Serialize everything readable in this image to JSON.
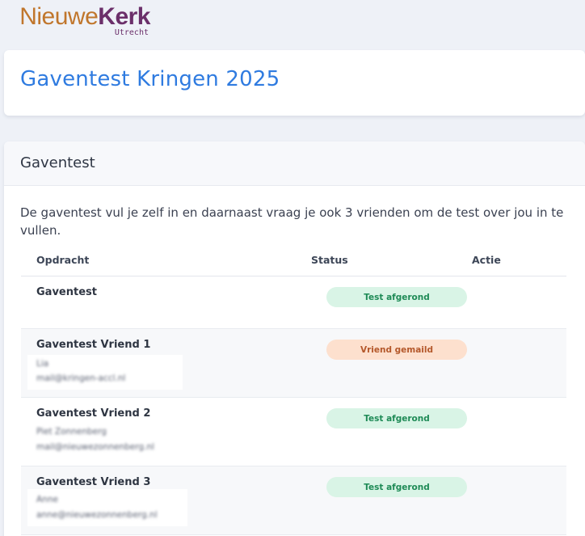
{
  "logo": {
    "part1": "Nieuwe",
    "part2": "Kerk",
    "sub": "Utrecht",
    "color_part1": "#c0762c",
    "color_part2": "#6b2f6a"
  },
  "page": {
    "title": "Gaventest Kringen 2025"
  },
  "card": {
    "title": "Gaventest",
    "intro": "De gaventest vul je zelf in en daarnaast vraag je ook 3 vrienden om de test over jou in te vullen."
  },
  "table": {
    "headers": [
      "Opdracht",
      "Status",
      "Actie"
    ],
    "rows": [
      {
        "title": "Gaventest",
        "status": "Test afgerond",
        "status_color": "green",
        "line1": "",
        "line2": ""
      },
      {
        "title": "Gaventest Vriend 1",
        "status": "Vriend gemaild",
        "status_color": "orange",
        "line1": "Lia",
        "line2": "mail@kringen-accl.nl"
      },
      {
        "title": "Gaventest Vriend 2",
        "status": "Test afgerond",
        "status_color": "green",
        "line1": "Piet Zonnenberg",
        "line2": "mail@nieuwezonnenberg.nl"
      },
      {
        "title": "Gaventest Vriend 3",
        "status": "Test afgerond",
        "status_color": "green",
        "line1": "Anne",
        "line2": "anne@nieuwezonnenberg.nl"
      }
    ]
  }
}
